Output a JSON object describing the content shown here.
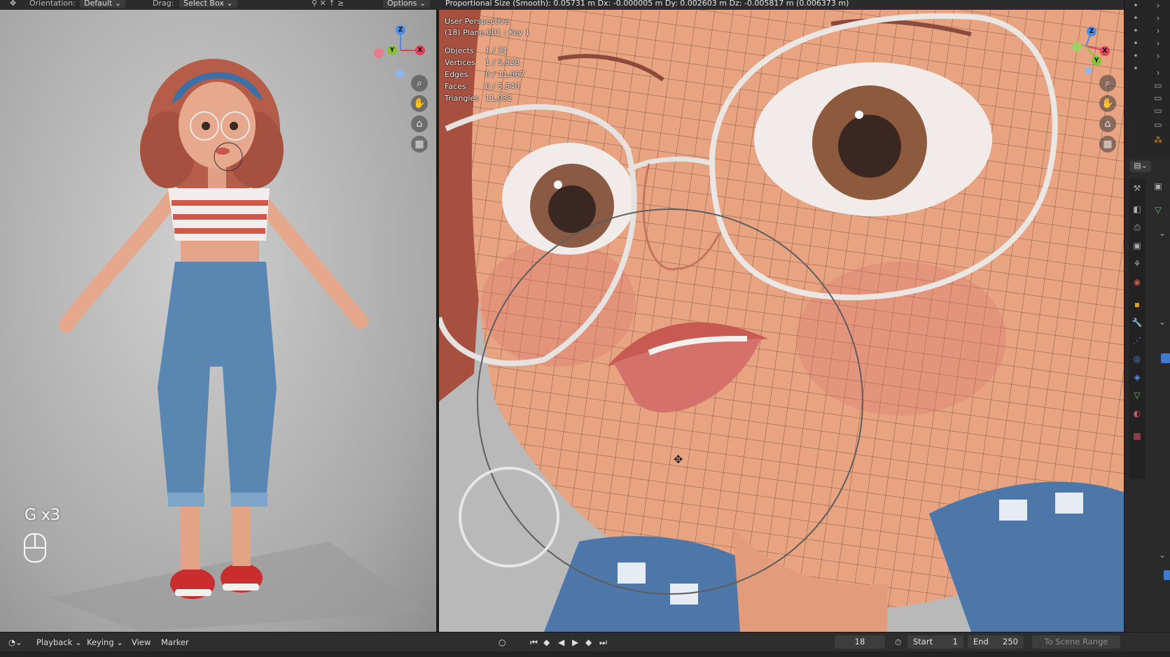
{
  "header": {
    "orientation_label": "Orientation:",
    "orientation_value": "Default",
    "drag_label": "Drag:",
    "drag_value": "Select Box",
    "options_label": "Options",
    "status_text": "Proportional Size (Smooth): 0.05731 m   Dx: -0.000005 m   Dy: 0.002603 m   Dz: -0.005817 m (0.006373 m)"
  },
  "left_viewport": {
    "key_hint": "G x3",
    "gizmo": {
      "x": "X",
      "y": "Y",
      "z": "Z"
    }
  },
  "right_viewport": {
    "view_name": "User Perspective",
    "object_name": "(18) Plane.001 : Key 1",
    "stats": [
      {
        "label": "Objects",
        "value": "1 / 31"
      },
      {
        "label": "Vertices",
        "value": "1 / 5,528"
      },
      {
        "label": "Edges",
        "value": "0 / 11,067"
      },
      {
        "label": "Faces",
        "value": "0 / 5,540"
      },
      {
        "label": "Triangles",
        "value": "11,032"
      }
    ],
    "gizmo": {
      "x": "X",
      "y": "Y",
      "z": "Z"
    }
  },
  "timeline": {
    "menus": [
      "Playback",
      "Keying",
      "View",
      "Marker"
    ],
    "current_frame": "18",
    "start_label": "Start",
    "start_value": "1",
    "end_label": "End",
    "end_value": "250",
    "scene_range_label": "To Scene Range"
  },
  "icons": {
    "zoom": "magnifier-icon",
    "pan": "hand-icon",
    "camera": "camera-icon",
    "grid": "grid-icon",
    "mouse": "mouse-icon"
  },
  "colors": {
    "axis_x": "#e0405a",
    "axis_y": "#86c33a",
    "axis_z": "#4b8bea",
    "header_bg": "#2b2b2b",
    "panel_bg": "#2a2a2a"
  }
}
